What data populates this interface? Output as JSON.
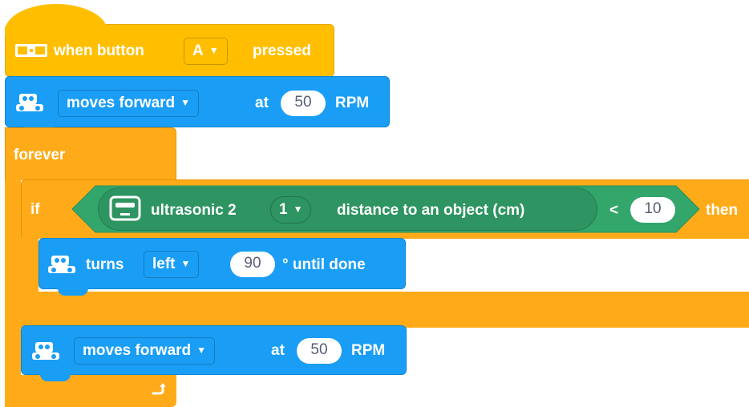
{
  "hat_block": {
    "when_label": "when button",
    "button_value": "A",
    "pressed_label": "pressed"
  },
  "move_block_1": {
    "direction": "moves forward",
    "at_label": "at",
    "speed": "50",
    "unit_label": "RPM"
  },
  "forever_block": {
    "label": "forever"
  },
  "if_block": {
    "if_label": "if",
    "then_label": "then",
    "sensor_label": "ultrasonic 2",
    "port_value": "1",
    "distance_label": "distance to an object (cm)",
    "operator": "<",
    "compare_value": "10"
  },
  "turn_block": {
    "turns_label": "turns",
    "direction": "left",
    "degrees": "90",
    "until_label": "° until done"
  },
  "move_block_2": {
    "direction": "moves forward",
    "at_label": "at",
    "speed": "50",
    "unit_label": "RPM"
  },
  "colors": {
    "event": "#ffbf00",
    "motion": "#1a9ef5",
    "control": "#ffab19",
    "sensor": "#33a66b"
  },
  "icons": [
    "button-icon",
    "robot-icon",
    "ultrasonic-sensor-icon",
    "loop-arrow-icon",
    "dropdown-triangle-icon"
  ]
}
